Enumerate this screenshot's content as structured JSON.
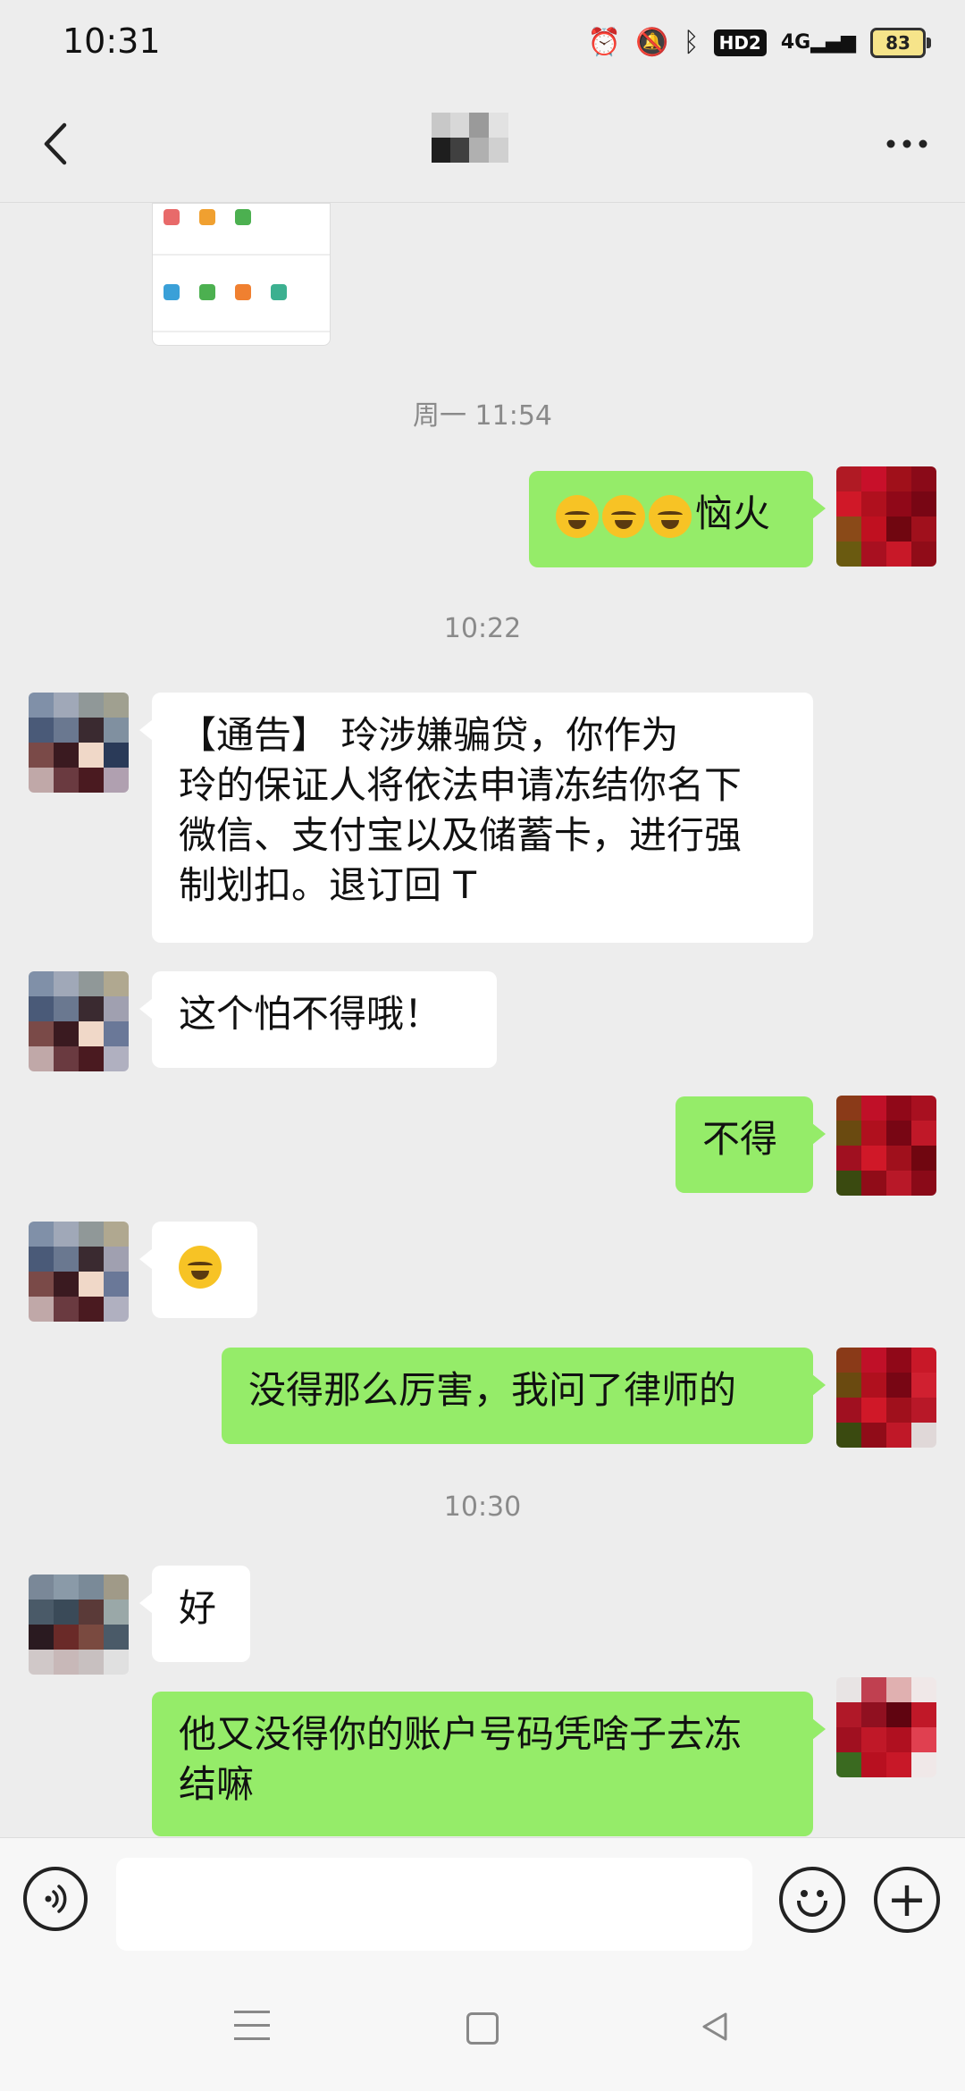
{
  "status_bar": {
    "time": "10:31",
    "hd": "HD2",
    "network": "4G",
    "battery": "83",
    "icons": [
      "alarm-icon",
      "mute-icon",
      "bluetooth-icon",
      "hd-icon",
      "signal-icon",
      "battery-icon"
    ]
  },
  "header": {
    "back_icon": "back-arrow-icon",
    "more_icon": "more-dots-icon"
  },
  "messages": [
    {
      "type": "timestamp",
      "text": "周一 11:54"
    },
    {
      "type": "out",
      "emojis": [
        "crying-face",
        "crying-face",
        "crying-face"
      ],
      "text": "恼火"
    },
    {
      "type": "timestamp",
      "text": "10:22"
    },
    {
      "type": "in",
      "text_lines": [
        "【通告】   玲涉嫌骗贷，你作为",
        "玲的保证人将依法申请冻结你名下",
        "微信、支付宝以及储蓄卡，进行强",
        "制划扣。退订回 T"
      ]
    },
    {
      "type": "in",
      "text": "这个怕不得哦！"
    },
    {
      "type": "out",
      "text": "不得"
    },
    {
      "type": "in",
      "emoji": "crying-angry-face"
    },
    {
      "type": "out",
      "text": "没得那么厉害，我问了律师的"
    },
    {
      "type": "timestamp",
      "text": "10:30"
    },
    {
      "type": "in",
      "text": "好"
    },
    {
      "type": "out",
      "text_lines": [
        "他又没得你的账户号码凭啥子去冻",
        "结嘛"
      ]
    }
  ],
  "input_bar": {
    "voice_icon": "voice-icon",
    "emoji_icon": "emoji-icon",
    "plus_icon": "plus-icon",
    "value": ""
  },
  "colors": {
    "background": "#ededed",
    "outgoing_bubble": "#95ec69",
    "incoming_bubble": "#ffffff",
    "timestamp": "#8a8a8a"
  }
}
